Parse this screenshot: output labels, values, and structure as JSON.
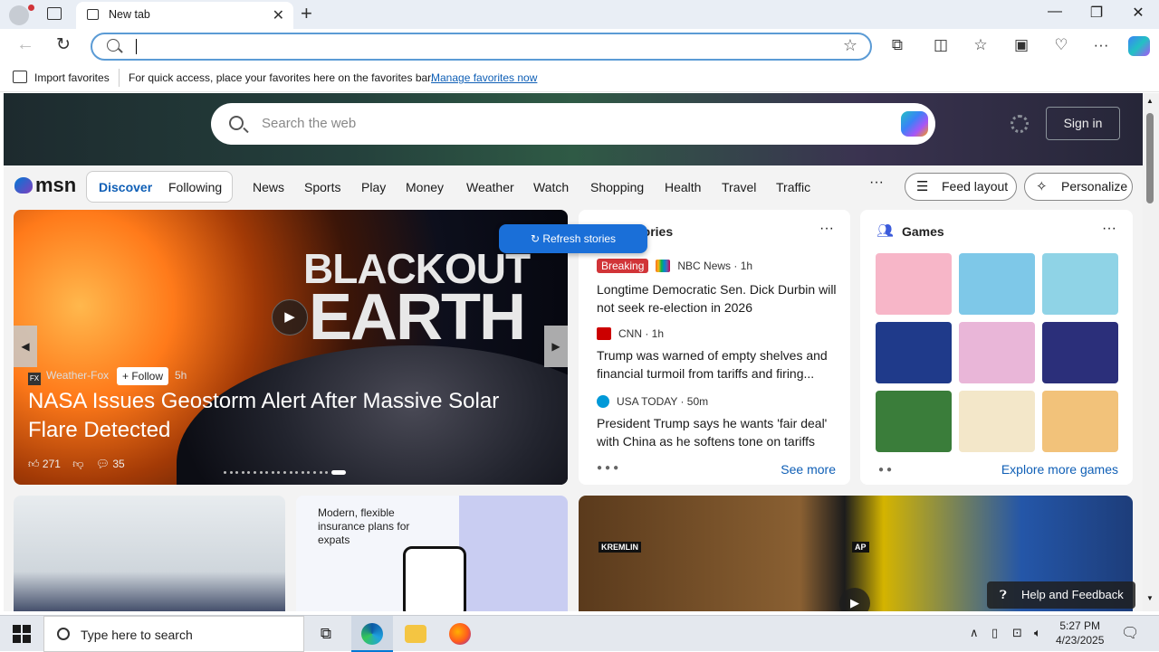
{
  "browser": {
    "tab_title": "New tab",
    "new_tab_symbol": "+",
    "close_symbol": "✕",
    "favorites_bar": {
      "import_label": "Import favorites",
      "message": "For quick access, place your favorites here on the favorites bar.",
      "manage_link": "Manage favorites now"
    }
  },
  "msn": {
    "search_placeholder": "Search the web",
    "sign_in": "Sign in",
    "logo": "msn",
    "tabs": [
      "Discover",
      "Following"
    ],
    "nav": [
      "News",
      "Sports",
      "Play",
      "Money",
      "Weather",
      "Watch",
      "Shopping",
      "Health",
      "Travel",
      "Traffic"
    ],
    "more": "···",
    "feed_layout": "Feed layout",
    "personalize": "Personalize",
    "refresh_stories": "Refresh stories"
  },
  "featured": {
    "title_line1": "BLACKOUT",
    "title_line2": "EARTH",
    "source": "Weather-Fox",
    "source_logo": "FX",
    "follow": "Follow",
    "age": "5h",
    "headline": "NASA Issues Geostorm Alert After Massive Solar Flare Detected",
    "likes": "271",
    "comments": "35"
  },
  "top_stories": {
    "header": "Top stories",
    "header_visible": "tories",
    "stories": [
      {
        "badge": "Breaking",
        "source": "NBC News · 1h",
        "title": "Longtime Democratic Sen. Dick Durbin will not seek re-election in 2026"
      },
      {
        "badge": "",
        "source": "CNN · 1h",
        "title": "Trump was warned of empty shelves and financial turmoil from tariffs and firing..."
      },
      {
        "badge": "",
        "source": "USA TODAY · 50m",
        "title": "President Trump says he wants 'fair deal' with China as he softens tone on tariffs"
      }
    ],
    "see_more": "See more"
  },
  "games": {
    "header": "Games",
    "explore": "Explore more games",
    "tile_colors": [
      "#f7b6c8",
      "#7ec8e8",
      "#8fd3e6",
      "#1f3a8a",
      "#e9b6d8",
      "#2b2f7a",
      "#3a7d3a",
      "#f3e7c9",
      "#f2c27a"
    ]
  },
  "bottom_cards": {
    "insurance_text": "Modern, flexible insurance plans for expats",
    "kremlin_label": "KREMLIN",
    "ap_label": "AP"
  },
  "help_feedback": "Help and Feedback",
  "taskbar": {
    "search_placeholder": "Type here to search",
    "time": "5:27 PM",
    "date": "4/23/2025"
  }
}
